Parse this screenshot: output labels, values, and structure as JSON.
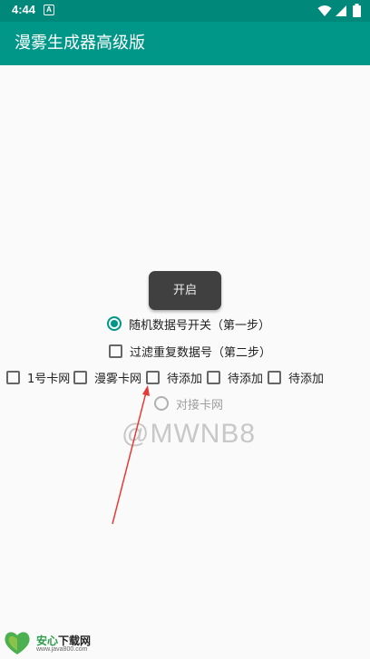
{
  "status_bar": {
    "time": "4:44",
    "notification_icon": "A"
  },
  "app": {
    "title": "漫雾生成器高级版"
  },
  "start_button": {
    "label": "开启"
  },
  "options": {
    "random_switch": {
      "label": "随机数据号开关（第一步）",
      "checked": true
    },
    "filter_duplicates": {
      "label": "过滤重复数据号（第二步）",
      "checked": false
    }
  },
  "card_networks": [
    {
      "label": "1号卡网",
      "checked": false
    },
    {
      "label": "漫雾卡网",
      "checked": false
    },
    {
      "label": "待添加",
      "checked": false
    },
    {
      "label": "待添加",
      "checked": false
    },
    {
      "label": "待添加",
      "checked": false
    }
  ],
  "dock_network": {
    "label": "对接卡网",
    "enabled": false,
    "checked": false
  },
  "watermark": {
    "text": "@MWNB8"
  },
  "site_badge": {
    "name": "安心",
    "name_suffix": "下载网",
    "url": "www.java800.com"
  },
  "colors": {
    "status_bar": "#00897b",
    "app_bar": "#009688",
    "accent": "#009688",
    "arrow": "#e53935"
  },
  "icons": [
    "wifi-icon",
    "signal-icon",
    "battery-icon",
    "notification-icon"
  ]
}
